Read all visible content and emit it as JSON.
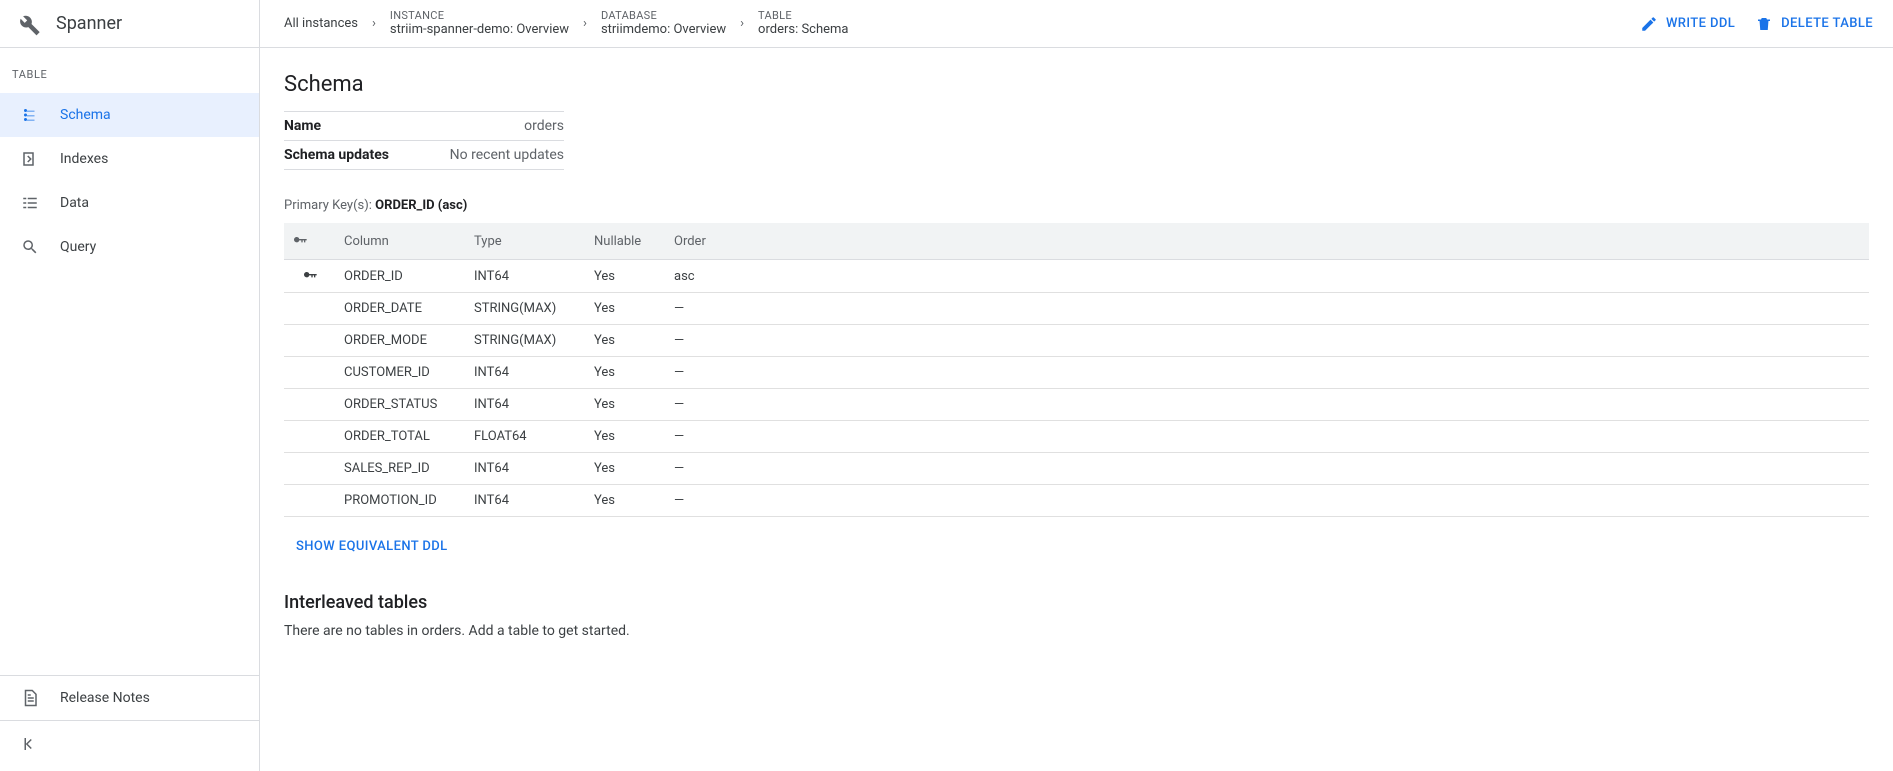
{
  "brand": {
    "title": "Spanner"
  },
  "breadcrumbs": {
    "root": "All instances",
    "instance": {
      "label": "INSTANCE",
      "value": "striim-spanner-demo: Overview"
    },
    "database": {
      "label": "DATABASE",
      "value": "striimdemo: Overview"
    },
    "table": {
      "label": "TABLE",
      "value": "orders: Schema"
    }
  },
  "actions": {
    "write_ddl": "WRITE DDL",
    "delete_table": "DELETE TABLE"
  },
  "sidebar": {
    "header": "TABLE",
    "items": [
      {
        "label": "Schema",
        "active": true
      },
      {
        "label": "Indexes",
        "active": false
      },
      {
        "label": "Data",
        "active": false
      },
      {
        "label": "Query",
        "active": false
      }
    ],
    "release_notes": "Release Notes"
  },
  "main": {
    "heading": "Schema",
    "meta": {
      "name_label": "Name",
      "name_value": "orders",
      "updates_label": "Schema updates",
      "updates_value": "No recent updates"
    },
    "primary_key_label": "Primary Key(s): ",
    "primary_key_value": "ORDER_ID (asc)",
    "table_headers": {
      "column": "Column",
      "type": "Type",
      "nullable": "Nullable",
      "order": "Order"
    },
    "columns": [
      {
        "key": true,
        "name": "ORDER_ID",
        "type": "INT64",
        "nullable": "Yes",
        "order": "asc"
      },
      {
        "key": false,
        "name": "ORDER_DATE",
        "type": "STRING(MAX)",
        "nullable": "Yes",
        "order": "—"
      },
      {
        "key": false,
        "name": "ORDER_MODE",
        "type": "STRING(MAX)",
        "nullable": "Yes",
        "order": "—"
      },
      {
        "key": false,
        "name": "CUSTOMER_ID",
        "type": "INT64",
        "nullable": "Yes",
        "order": "—"
      },
      {
        "key": false,
        "name": "ORDER_STATUS",
        "type": "INT64",
        "nullable": "Yes",
        "order": "—"
      },
      {
        "key": false,
        "name": "ORDER_TOTAL",
        "type": "FLOAT64",
        "nullable": "Yes",
        "order": "—"
      },
      {
        "key": false,
        "name": "SALES_REP_ID",
        "type": "INT64",
        "nullable": "Yes",
        "order": "—"
      },
      {
        "key": false,
        "name": "PROMOTION_ID",
        "type": "INT64",
        "nullable": "Yes",
        "order": "—"
      }
    ],
    "show_ddl": "SHOW EQUIVALENT DDL",
    "interleaved_heading": "Interleaved tables",
    "interleaved_text": "There are no tables in orders. Add a table to get started."
  }
}
